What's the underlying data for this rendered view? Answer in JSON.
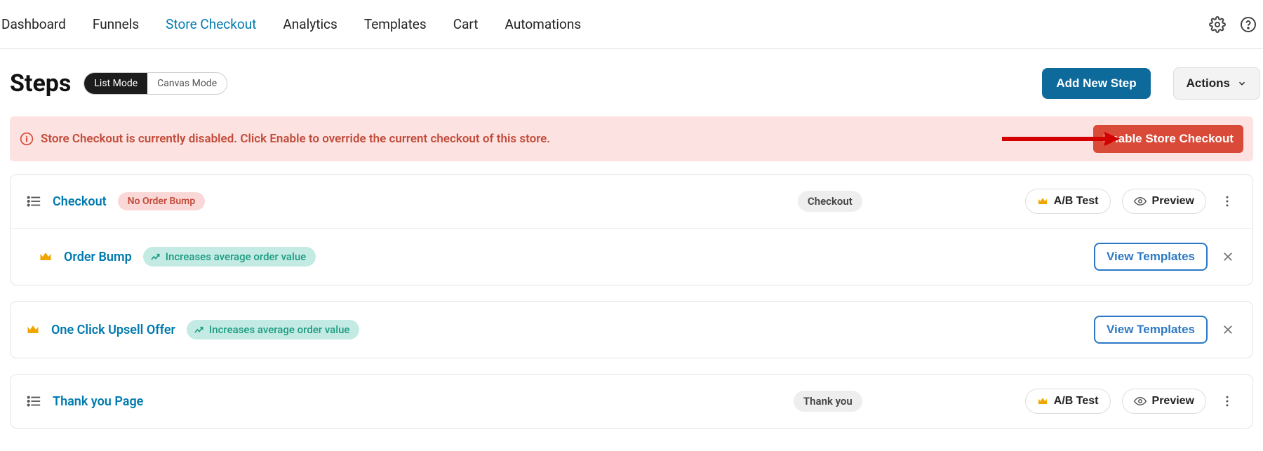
{
  "nav": {
    "items": [
      "Dashboard",
      "Funnels",
      "Store Checkout",
      "Analytics",
      "Templates",
      "Cart",
      "Automations"
    ],
    "activeIndex": 2
  },
  "header": {
    "title": "Steps",
    "modes": {
      "list": "List Mode",
      "canvas": "Canvas Mode",
      "activeIndex": 0
    },
    "add_btn": "Add New Step",
    "actions_btn": "Actions"
  },
  "alert": {
    "text": "Store Checkout is currently disabled. Click Enable to override the current checkout of this store.",
    "button": "Enable Store Checkout"
  },
  "rows": {
    "checkout": {
      "label": "Checkout",
      "chip": "No Order Bump",
      "type_chip": "Checkout",
      "ab": "A/B Test",
      "preview": "Preview"
    },
    "orderbump": {
      "label": "Order Bump",
      "hint": "Increases average order value",
      "view_templates": "View Templates"
    },
    "upsell": {
      "label": "One Click Upsell Offer",
      "hint": "Increases average order value",
      "view_templates": "View Templates"
    },
    "thankyou": {
      "label": "Thank you Page",
      "type_chip": "Thank you",
      "ab": "A/B Test",
      "preview": "Preview"
    }
  }
}
